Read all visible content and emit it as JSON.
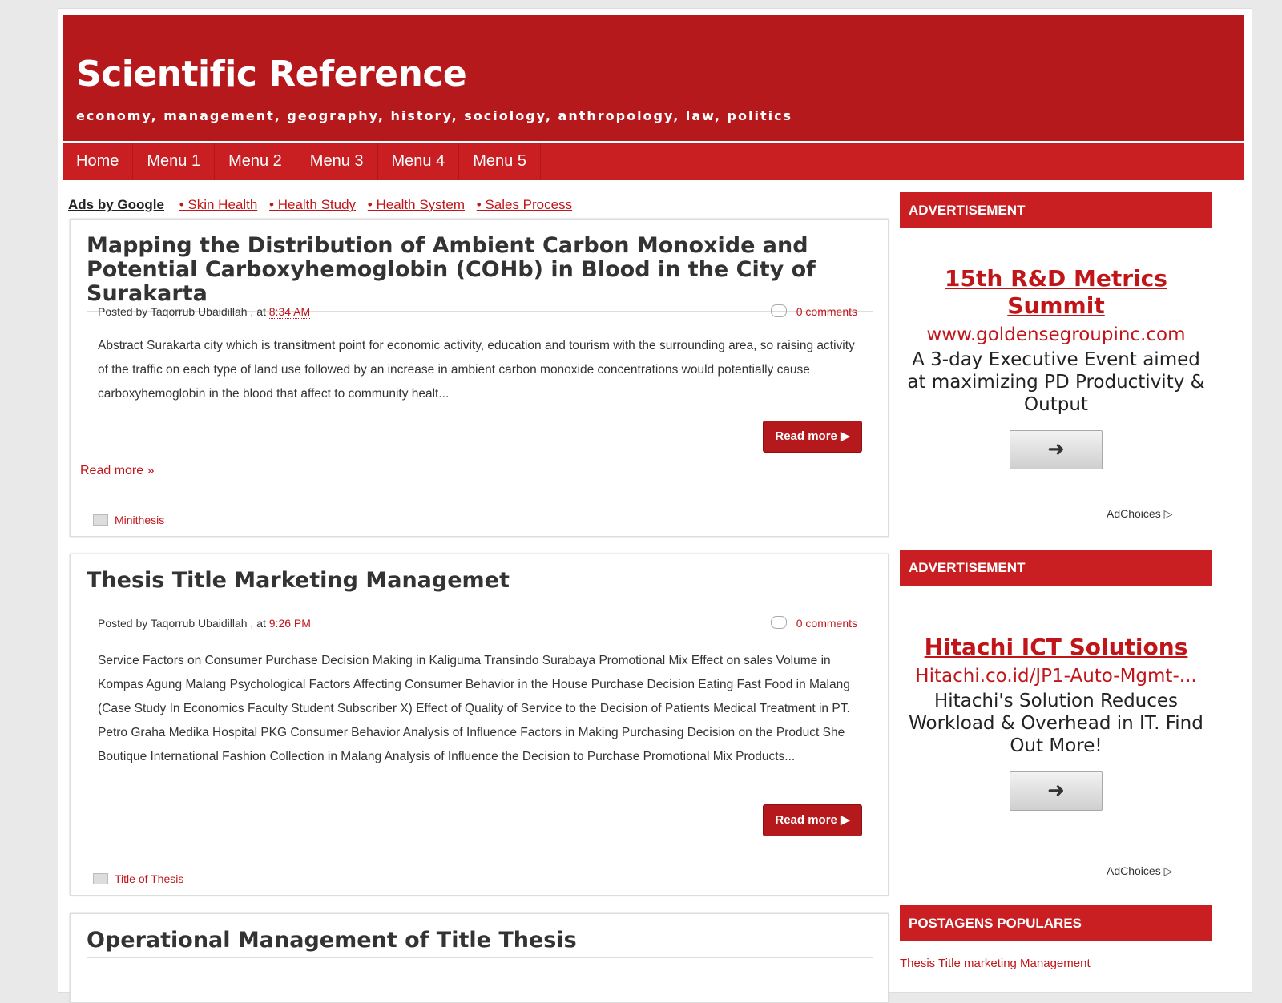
{
  "site": {
    "title": "Scientific Reference",
    "description": "economy, management, geography, history, sociology, anthropology, law, politics"
  },
  "nav": [
    "Home",
    "Menu 1",
    "Menu 2",
    "Menu 3",
    "Menu 4",
    "Menu 5"
  ],
  "ads_row": {
    "label": "Ads by Google",
    "links": [
      "• Skin Health",
      "• Health Study",
      "• Health System",
      "• Sales Process"
    ]
  },
  "posts": [
    {
      "title": "Mapping the Distribution of Ambient Carbon Monoxide and Potential Carboxyhemoglobin (COHb) in Blood in the City of Surakarta",
      "posted_by": "Posted by Taqorrub Ubaidillah , at ",
      "time": "8:34 AM",
      "comments": "0 comments",
      "body": "Abstract Surakarta city which is transitment point for economic activity, education and tourism with the surrounding area, so raising activity of the traffic on each type of land use followed by an increase in ambient carbon monoxide concentrations would potentially cause carboxyhemoglobin in the blood that affect to community healt...",
      "read_more_button": "Read more ▶",
      "read_more_link": "Read more »",
      "label": "Minithesis"
    },
    {
      "title": "Thesis Title Marketing Managemet",
      "posted_by": "Posted by Taqorrub Ubaidillah , at ",
      "time": "9:26 PM",
      "comments": "0 comments",
      "body": "Service Factors on Consumer Purchase Decision Making in Kaliguma Transindo Surabaya Promotional Mix Effect on sales Volume in Kompas Agung Malang Psychological Factors Affecting Consumer Behavior in the House Purchase Decision Eating Fast Food in Malang (Case Study In Economics Faculty Student Subscriber X) Effect of Quality of Service to the Decision of Patients Medical Treatment in PT. Petro Graha Medika Hospital PKG Consumer Behavior Analysis of Influence Factors in Making Purchasing Decision on the Product She Boutique International Fashion Collection in Malang Analysis of Influence the Decision to Purchase Promotional Mix Products...",
      "read_more_button": "Read more ▶",
      "label": "Title of Thesis"
    },
    {
      "title": "Operational Management of Title Thesis"
    }
  ],
  "sidebar": {
    "ad_heading_1": "ADVERTISEMENT",
    "ad1": {
      "title": "15th R&D Metrics Summit",
      "url": "www.goldensegroupinc.com",
      "text": "A 3-day Executive Event aimed at maximizing PD Productivity & Output",
      "arrow": "➜",
      "adchoices": "AdChoices ▷"
    },
    "ad_heading_2": "ADVERTISEMENT",
    "ad2": {
      "title": "Hitachi ICT Solutions",
      "url": "Hitachi.co.id/JP1-Auto-Mgmt-...",
      "text": "Hitachi's Solution Reduces Workload & Overhead in IT. Find Out More!",
      "arrow": "➜",
      "adchoices": "AdChoices ▷"
    },
    "popular_heading": "POSTAGENS POPULARES",
    "popular_items": [
      "Thesis Title marketing Management"
    ]
  },
  "colors": {
    "brand_red": "#b5191c",
    "nav_red": "#c91e22",
    "link_red": "#c0161a"
  }
}
